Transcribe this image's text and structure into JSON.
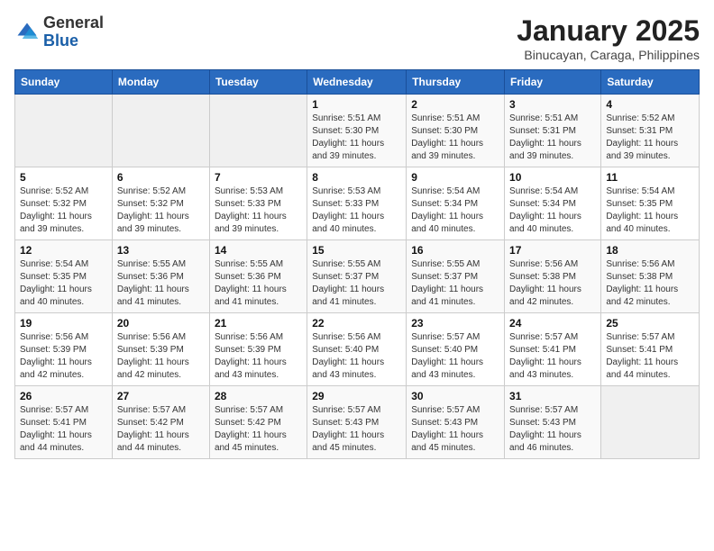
{
  "header": {
    "logo_general": "General",
    "logo_blue": "Blue",
    "title": "January 2025",
    "subtitle": "Binucayan, Caraga, Philippines"
  },
  "weekdays": [
    "Sunday",
    "Monday",
    "Tuesday",
    "Wednesday",
    "Thursday",
    "Friday",
    "Saturday"
  ],
  "weeks": [
    [
      {
        "num": "",
        "info": ""
      },
      {
        "num": "",
        "info": ""
      },
      {
        "num": "",
        "info": ""
      },
      {
        "num": "1",
        "info": "Sunrise: 5:51 AM\nSunset: 5:30 PM\nDaylight: 11 hours and 39 minutes."
      },
      {
        "num": "2",
        "info": "Sunrise: 5:51 AM\nSunset: 5:30 PM\nDaylight: 11 hours and 39 minutes."
      },
      {
        "num": "3",
        "info": "Sunrise: 5:51 AM\nSunset: 5:31 PM\nDaylight: 11 hours and 39 minutes."
      },
      {
        "num": "4",
        "info": "Sunrise: 5:52 AM\nSunset: 5:31 PM\nDaylight: 11 hours and 39 minutes."
      }
    ],
    [
      {
        "num": "5",
        "info": "Sunrise: 5:52 AM\nSunset: 5:32 PM\nDaylight: 11 hours and 39 minutes."
      },
      {
        "num": "6",
        "info": "Sunrise: 5:52 AM\nSunset: 5:32 PM\nDaylight: 11 hours and 39 minutes."
      },
      {
        "num": "7",
        "info": "Sunrise: 5:53 AM\nSunset: 5:33 PM\nDaylight: 11 hours and 39 minutes."
      },
      {
        "num": "8",
        "info": "Sunrise: 5:53 AM\nSunset: 5:33 PM\nDaylight: 11 hours and 40 minutes."
      },
      {
        "num": "9",
        "info": "Sunrise: 5:54 AM\nSunset: 5:34 PM\nDaylight: 11 hours and 40 minutes."
      },
      {
        "num": "10",
        "info": "Sunrise: 5:54 AM\nSunset: 5:34 PM\nDaylight: 11 hours and 40 minutes."
      },
      {
        "num": "11",
        "info": "Sunrise: 5:54 AM\nSunset: 5:35 PM\nDaylight: 11 hours and 40 minutes."
      }
    ],
    [
      {
        "num": "12",
        "info": "Sunrise: 5:54 AM\nSunset: 5:35 PM\nDaylight: 11 hours and 40 minutes."
      },
      {
        "num": "13",
        "info": "Sunrise: 5:55 AM\nSunset: 5:36 PM\nDaylight: 11 hours and 41 minutes."
      },
      {
        "num": "14",
        "info": "Sunrise: 5:55 AM\nSunset: 5:36 PM\nDaylight: 11 hours and 41 minutes."
      },
      {
        "num": "15",
        "info": "Sunrise: 5:55 AM\nSunset: 5:37 PM\nDaylight: 11 hours and 41 minutes."
      },
      {
        "num": "16",
        "info": "Sunrise: 5:55 AM\nSunset: 5:37 PM\nDaylight: 11 hours and 41 minutes."
      },
      {
        "num": "17",
        "info": "Sunrise: 5:56 AM\nSunset: 5:38 PM\nDaylight: 11 hours and 42 minutes."
      },
      {
        "num": "18",
        "info": "Sunrise: 5:56 AM\nSunset: 5:38 PM\nDaylight: 11 hours and 42 minutes."
      }
    ],
    [
      {
        "num": "19",
        "info": "Sunrise: 5:56 AM\nSunset: 5:39 PM\nDaylight: 11 hours and 42 minutes."
      },
      {
        "num": "20",
        "info": "Sunrise: 5:56 AM\nSunset: 5:39 PM\nDaylight: 11 hours and 42 minutes."
      },
      {
        "num": "21",
        "info": "Sunrise: 5:56 AM\nSunset: 5:39 PM\nDaylight: 11 hours and 43 minutes."
      },
      {
        "num": "22",
        "info": "Sunrise: 5:56 AM\nSunset: 5:40 PM\nDaylight: 11 hours and 43 minutes."
      },
      {
        "num": "23",
        "info": "Sunrise: 5:57 AM\nSunset: 5:40 PM\nDaylight: 11 hours and 43 minutes."
      },
      {
        "num": "24",
        "info": "Sunrise: 5:57 AM\nSunset: 5:41 PM\nDaylight: 11 hours and 43 minutes."
      },
      {
        "num": "25",
        "info": "Sunrise: 5:57 AM\nSunset: 5:41 PM\nDaylight: 11 hours and 44 minutes."
      }
    ],
    [
      {
        "num": "26",
        "info": "Sunrise: 5:57 AM\nSunset: 5:41 PM\nDaylight: 11 hours and 44 minutes."
      },
      {
        "num": "27",
        "info": "Sunrise: 5:57 AM\nSunset: 5:42 PM\nDaylight: 11 hours and 44 minutes."
      },
      {
        "num": "28",
        "info": "Sunrise: 5:57 AM\nSunset: 5:42 PM\nDaylight: 11 hours and 45 minutes."
      },
      {
        "num": "29",
        "info": "Sunrise: 5:57 AM\nSunset: 5:43 PM\nDaylight: 11 hours and 45 minutes."
      },
      {
        "num": "30",
        "info": "Sunrise: 5:57 AM\nSunset: 5:43 PM\nDaylight: 11 hours and 45 minutes."
      },
      {
        "num": "31",
        "info": "Sunrise: 5:57 AM\nSunset: 5:43 PM\nDaylight: 11 hours and 46 minutes."
      },
      {
        "num": "",
        "info": ""
      }
    ]
  ]
}
